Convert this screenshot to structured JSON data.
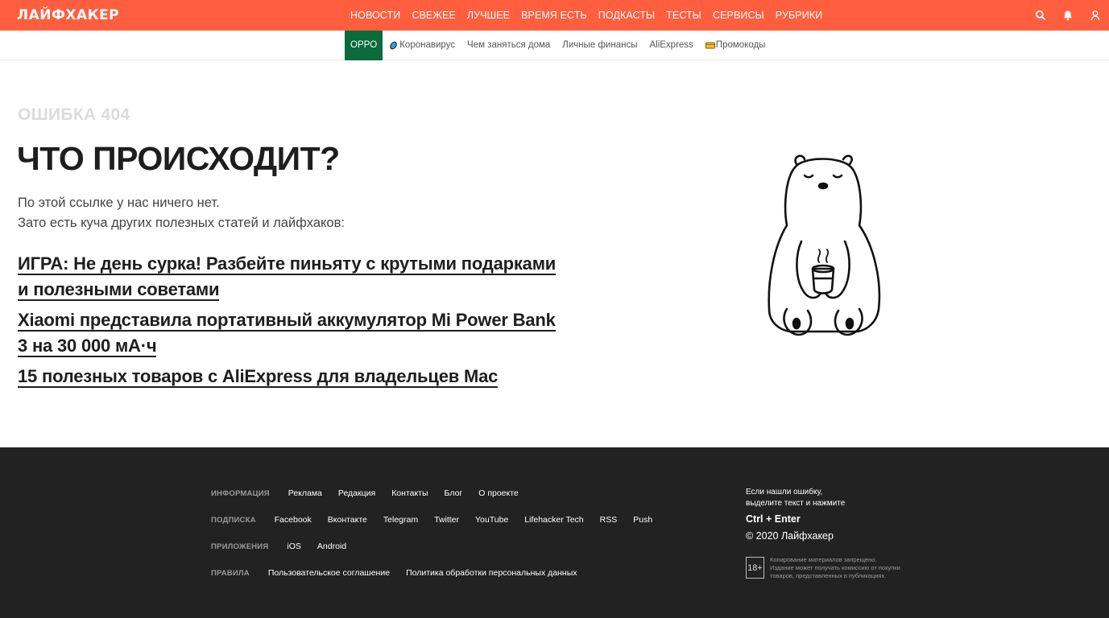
{
  "header": {
    "logo": "ЛАЙФХАКЕР",
    "nav": [
      "НОВОСТИ",
      "СВЕЖЕЕ",
      "ЛУЧШЕЕ",
      "ВРЕМЯ ЕСТЬ",
      "ПОДКАСТЫ",
      "ТЕСТЫ",
      "СЕРВИСЫ",
      "РУБРИКИ"
    ],
    "icons": [
      "search-icon",
      "bell-icon",
      "user-icon"
    ],
    "accent_color": "#ff5f3f"
  },
  "subnav": {
    "items": [
      {
        "label": "OPPO",
        "icon": null
      },
      {
        "label": "Коронавирус",
        "icon": "virus-icon"
      },
      {
        "label": "Чем заняться дома",
        "icon": null
      },
      {
        "label": "Личные финансы",
        "icon": null
      },
      {
        "label": "AliExpress",
        "icon": null
      },
      {
        "label": "Промокоды",
        "icon": "coupon-icon"
      }
    ],
    "oppo_color": "#0b6b3a"
  },
  "main": {
    "error_label": "ОШИБКА 404",
    "title": "ЧТО ПРОИСХОДИТ?",
    "intro_line1": "По этой ссылке у нас ничего нет.",
    "intro_line2": "Зато есть куча других полезных статей и лайфхаков:",
    "links": [
      "ИГРА: Не день сурка! Разбейте пиньяту с крутыми подарками и полезными советами",
      "Xiaomi представила портативный аккумулятор Mi Power Bank 3 на 30 000 мА·ч",
      "15 полезных товаров с AliExpress для владельцев Mac"
    ]
  },
  "footer": {
    "rows": [
      {
        "label": "ИНФОРМАЦИЯ",
        "links": [
          "Реклама",
          "Редакция",
          "Контакты",
          "Блог",
          "О проекте"
        ]
      },
      {
        "label": "ПОДПИСКА",
        "links": [
          "Facebook",
          "Вконтакте",
          "Telegram",
          "Twitter",
          "YouTube",
          "Lifehacker Tech",
          "RSS",
          "Push"
        ]
      },
      {
        "label": "ПРИЛОЖЕНИЯ",
        "links": [
          "iOS",
          "Android"
        ]
      },
      {
        "label": "ПРАВИЛА",
        "links": [
          "Пользовательское соглашение",
          "Политика обработки персональных данных"
        ]
      }
    ],
    "tip_line1": "Если нашли ошибку,",
    "tip_line2": "выделите текст и нажмите",
    "keys": "Ctrl + Enter",
    "copyright": "© 2020 Лайфхакер",
    "age": "18+",
    "legal_line1": "Копирование материалов запрещено.",
    "legal_line2": "Издание может получать комиссию от покупки",
    "legal_line3": "товаров, представленных в публикациях.",
    "background_color": "#222222"
  }
}
